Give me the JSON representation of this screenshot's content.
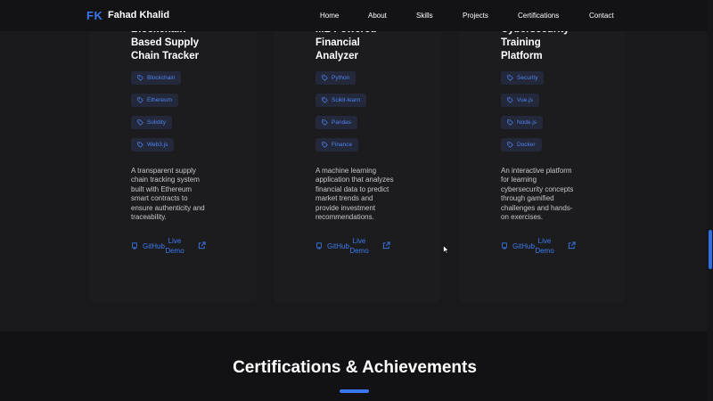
{
  "nav": {
    "logo_initials": "FK",
    "logo_name": "Fahad Khalid",
    "links": [
      "Home",
      "About",
      "Skills",
      "Projects",
      "Certifications",
      "Contact"
    ]
  },
  "projects": [
    {
      "title_lines": [
        "Blockchain",
        "Based Supply",
        "Chain Tracker"
      ],
      "tags": [
        "Blockchain",
        "Ethereum",
        "Solidity",
        "Web3.js"
      ],
      "description": "A transparent supply chain tracking system built with Ethereum smart contracts to ensure authenticity and traceability.",
      "github_label": "GitHub",
      "live_label": "Live Demo"
    },
    {
      "title_lines": [
        "ML-Powered",
        "Financial",
        "Analyzer"
      ],
      "tags": [
        "Python",
        "Scikit-learn",
        "Pandas",
        "Finance"
      ],
      "description": "A machine learning application that analyzes financial data to predict market trends and provide investment recommendations.",
      "github_label": "GitHub",
      "live_label": "Live Demo"
    },
    {
      "title_lines": [
        "Cybersecurity",
        "Training",
        "Platform"
      ],
      "tags": [
        "Security",
        "Vue.js",
        "Node.js",
        "Docker"
      ],
      "description": "An interactive platform for learning cybersecurity concepts through gamified challenges and hands-on exercises.",
      "github_label": "GitHub",
      "live_label": "Live Demo"
    }
  ],
  "certifications": {
    "heading": "Certifications & Achievements"
  },
  "colors": {
    "accent": "#3b76ee",
    "background": "#1a1a1c",
    "tag_bg": "#23283a"
  }
}
